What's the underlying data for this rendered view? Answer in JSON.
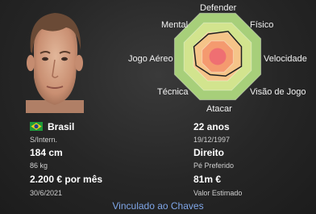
{
  "player": {
    "nationality": "Brasil",
    "intl_status": "S/Intern.",
    "height": "184 cm",
    "weight": "86 kg",
    "wage": "2.200 € por mês",
    "contract_end": "30/6/2021",
    "age": "22 anos",
    "birth_date": "19/12/1997",
    "preferred_foot": "Direito",
    "preferred_foot_label": "Pé Preferido",
    "value": "81m €",
    "value_label": "Valor Estimado"
  },
  "attributes": {
    "labels": {
      "defender": "Defender",
      "fisico": "Físico",
      "velocidade": "Velocidade",
      "visao": "Visão de Jogo",
      "atacar": "Atacar",
      "tecnica": "Técnica",
      "jogo_aereo": "Jogo Aéreo",
      "mental": "Mental"
    },
    "levels": {
      "defender": 0.58,
      "fisico": 0.55,
      "velocidade": 0.55,
      "visao": 0.45,
      "atacar": 0.42,
      "tecnica": 0.5,
      "jogo_aereo": 0.55,
      "mental": 0.52
    },
    "colors": {
      "ring_outer": "#a7cf7a",
      "ring_2": "#d2e48e",
      "ring_3": "#f5c489",
      "ring_4": "#f49a6f",
      "ring_inner": "#ef6f72",
      "outline": "#1f1f1f"
    }
  },
  "contract_status": "Vinculado ao Chaves",
  "colors": {
    "link": "#7fa6e8",
    "flag_green": "#1e9a3b",
    "flag_yellow": "#f3d21a",
    "flag_blue": "#24448e"
  }
}
